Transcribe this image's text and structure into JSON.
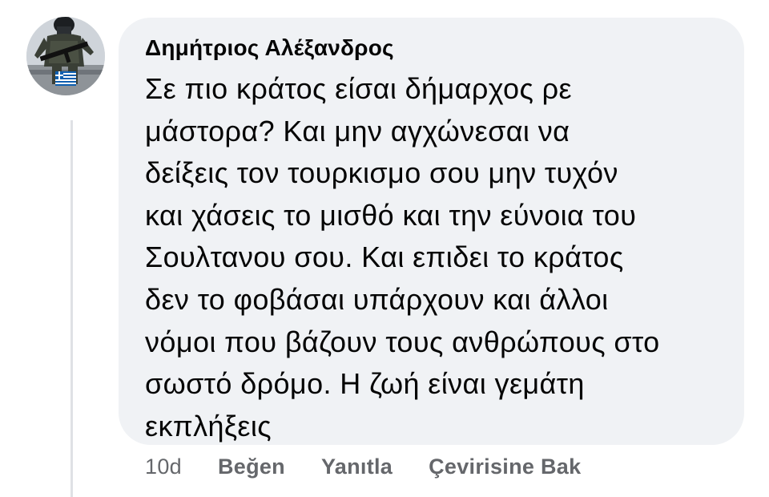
{
  "comment": {
    "author": "Δημήτριος Αλέξανδρος",
    "avatar_icon": "soldier-avatar-icon",
    "lines": [
      "Σε πιο κράτος είσαι δήμαρχος ρε",
      "μάστορα? Και μην αγχώνεσαι να",
      "δείξεις τον τουρκισμο σου μην τυχόν",
      "και χάσεις το μισθό και την εύνοια του",
      "Σουλτανου σου. Και επιδει το κράτος",
      "δεν το φοβάσαι υπάρχουν και άλλοι",
      "νόμοι που βάζουν τους ανθρώπους στο",
      "σωστό δρόμο. Η ζωή είναι γεμάτη",
      "εκπλήξεις"
    ]
  },
  "actions": {
    "timestamp": "10d",
    "like_label": "Beğen",
    "reply_label": "Yanıtla",
    "translate_label": "Çevirisine Bak"
  },
  "colors": {
    "bubble_bg": "#f0f2f5",
    "text": "#050505",
    "secondary_text": "#65676b",
    "thread_line": "#dfe1e5"
  }
}
